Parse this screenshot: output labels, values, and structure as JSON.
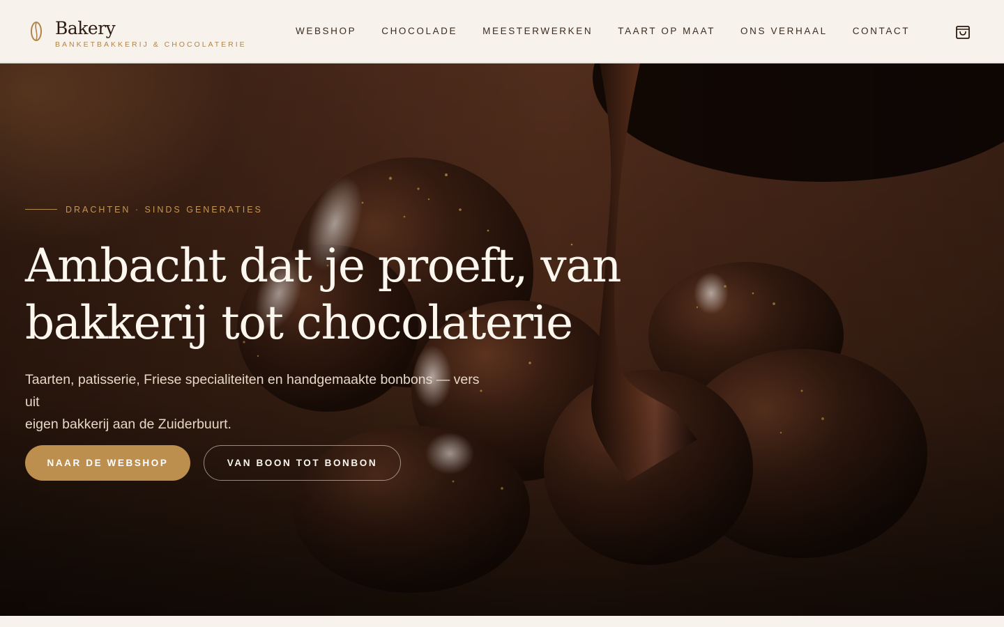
{
  "brand": {
    "name": "Bakery",
    "tagline": "BANKETBAKKERIJ & CHOCOLATERIE",
    "icon": "cocoa-bean-icon"
  },
  "nav": {
    "items": [
      {
        "label": "WEBSHOP"
      },
      {
        "label": "CHOCOLADE"
      },
      {
        "label": "MEESTERWERKEN"
      },
      {
        "label": "TAART OP MAAT"
      },
      {
        "label": "ONS VERHAAL"
      },
      {
        "label": "CONTACT"
      }
    ],
    "cart_icon": "shopping-bag-icon"
  },
  "hero": {
    "eyebrow": "DRACHTEN · SINDS GENERATIES",
    "title_line1": "Ambacht dat je proeft, van",
    "title_line2": "bakkerij tot chocolaterie",
    "subtitle_line1": "Taarten, patisserie, Friese specialiteiten en handgemaakte bonbons — vers uit",
    "subtitle_line2": "eigen bakkerij aan de Zuiderbuurt.",
    "primary_cta": "NAAR DE WEBSHOP",
    "secondary_cta": "VAN BOON TOT BONBON",
    "background_image": "chocolate-bonbons-with-pouring-chocolate"
  },
  "colors": {
    "accent_gold": "#bd8f4f",
    "page_cream": "#f7f3ec",
    "text_dark": "#2b1a10",
    "hero_dark": "#3b2113"
  }
}
